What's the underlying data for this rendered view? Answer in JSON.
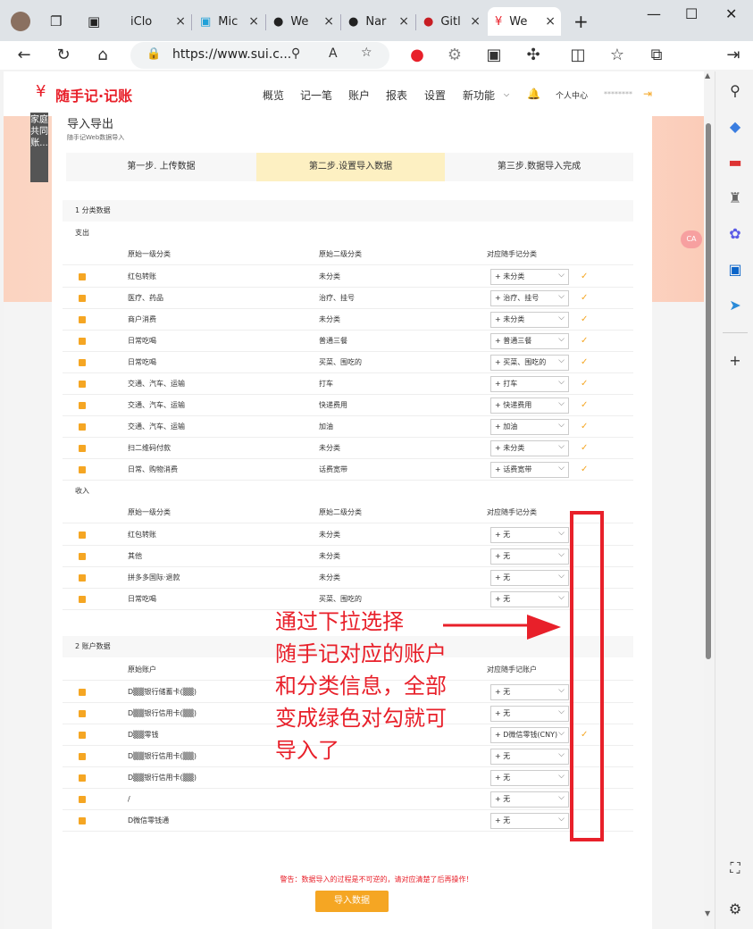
{
  "tabs": [
    {
      "label": "",
      "icon": "profile-avatar-icon"
    },
    {
      "label": "",
      "icon": "workspaces-icon"
    },
    {
      "label": "",
      "icon": "tab-actions-icon"
    },
    {
      "label": "iClo",
      "icon": "apple-icon"
    },
    {
      "label": "Mic",
      "icon": "bilibili-icon"
    },
    {
      "label": "We",
      "icon": "github-icon"
    },
    {
      "label": "Nar",
      "icon": "github-icon"
    },
    {
      "label": "Gitl",
      "icon": "gitee-icon"
    },
    {
      "label": "We",
      "icon": "sui-icon"
    }
  ],
  "tab_close": "×",
  "new_tab": "+",
  "window_controls": [
    "—",
    "☐",
    "✕"
  ],
  "address_bar": {
    "url": "https://www.sui.c..."
  },
  "site": {
    "logo_mark": "¥",
    "logo_text": "随手记·记账",
    "nav": [
      "概览",
      "记一笔",
      "账户",
      "报表",
      "设置",
      "新功能"
    ],
    "user_center": "个人中心",
    "user_name": "********",
    "side_tag": "家庭共同账..."
  },
  "page": {
    "title": "导入导出",
    "subtitle": "随手记Web数据导入",
    "steps": [
      "第一步. 上传数据",
      "第二步.设置导入数据",
      "第三步.数据导入完成"
    ],
    "section1": "1 分类数据",
    "expense_label": "支出",
    "income_label": "收入",
    "cat_headers": [
      "原始一级分类",
      "原始二级分类",
      "对应随手记分类"
    ],
    "expense_rows": [
      {
        "c1": "红包转账",
        "c2": "未分类",
        "sel": "未分类"
      },
      {
        "c1": "医疗、药品",
        "c2": "治疗、挂号",
        "sel": "治疗、挂号"
      },
      {
        "c1": "商户消费",
        "c2": "未分类",
        "sel": "未分类"
      },
      {
        "c1": "日常吃喝",
        "c2": "普通三餐",
        "sel": "普通三餐"
      },
      {
        "c1": "日常吃喝",
        "c2": "买菜、围吃的",
        "sel": "买菜、围吃的"
      },
      {
        "c1": "交通、汽车、运输",
        "c2": "打车",
        "sel": "打车"
      },
      {
        "c1": "交通、汽车、运输",
        "c2": "快递费用",
        "sel": "快递费用"
      },
      {
        "c1": "交通、汽车、运输",
        "c2": "加油",
        "sel": "加油"
      },
      {
        "c1": "扫二维码付款",
        "c2": "未分类",
        "sel": "未分类"
      },
      {
        "c1": "日常、购物消费",
        "c2": "话费宽带",
        "sel": "话费宽带"
      }
    ],
    "income_rows": [
      {
        "c1": "红包转账",
        "c2": "未分类",
        "sel": "无"
      },
      {
        "c1": "其他",
        "c2": "未分类",
        "sel": "无"
      },
      {
        "c1": "拼多多国际·退款",
        "c2": "未分类",
        "sel": "无"
      },
      {
        "c1": "日常吃喝",
        "c2": "买菜、围吃的",
        "sel": "无"
      }
    ],
    "section2": "2 账户数据",
    "acct_headers": [
      "原始账户",
      "对应随手记账户"
    ],
    "acct_rows": [
      {
        "c1": "D▒▒银行储蓄卡(▒▒)",
        "sel": "无",
        "ok": false
      },
      {
        "c1": "D▒▒银行信用卡(▒▒)",
        "sel": "无",
        "ok": false
      },
      {
        "c1": "D▒▒零钱",
        "sel": "D微信零钱(CNY)",
        "ok": true
      },
      {
        "c1": "D▒▒银行信用卡(▒▒)",
        "sel": "无",
        "ok": false
      },
      {
        "c1": "D▒▒银行信用卡(▒▒)",
        "sel": "无",
        "ok": false
      },
      {
        "c1": "/",
        "sel": "无",
        "ok": false
      },
      {
        "c1": "D微信零钱通",
        "sel": "无",
        "ok": false
      }
    ],
    "warning": "警告：数据导入的过程是不可逆的，请对应清楚了后再操作！",
    "import_button": "导入数据"
  },
  "annotation": {
    "lines": [
      "通过下拉选择",
      "随手记对应的账户",
      "和分类信息，全部",
      "变成绿色对勾就可",
      "导入了"
    ],
    "color": "#e8202a"
  },
  "colors": {
    "accent": "#f5a623",
    "brand": "#e8202a",
    "step_active": "#fdf0c2"
  }
}
